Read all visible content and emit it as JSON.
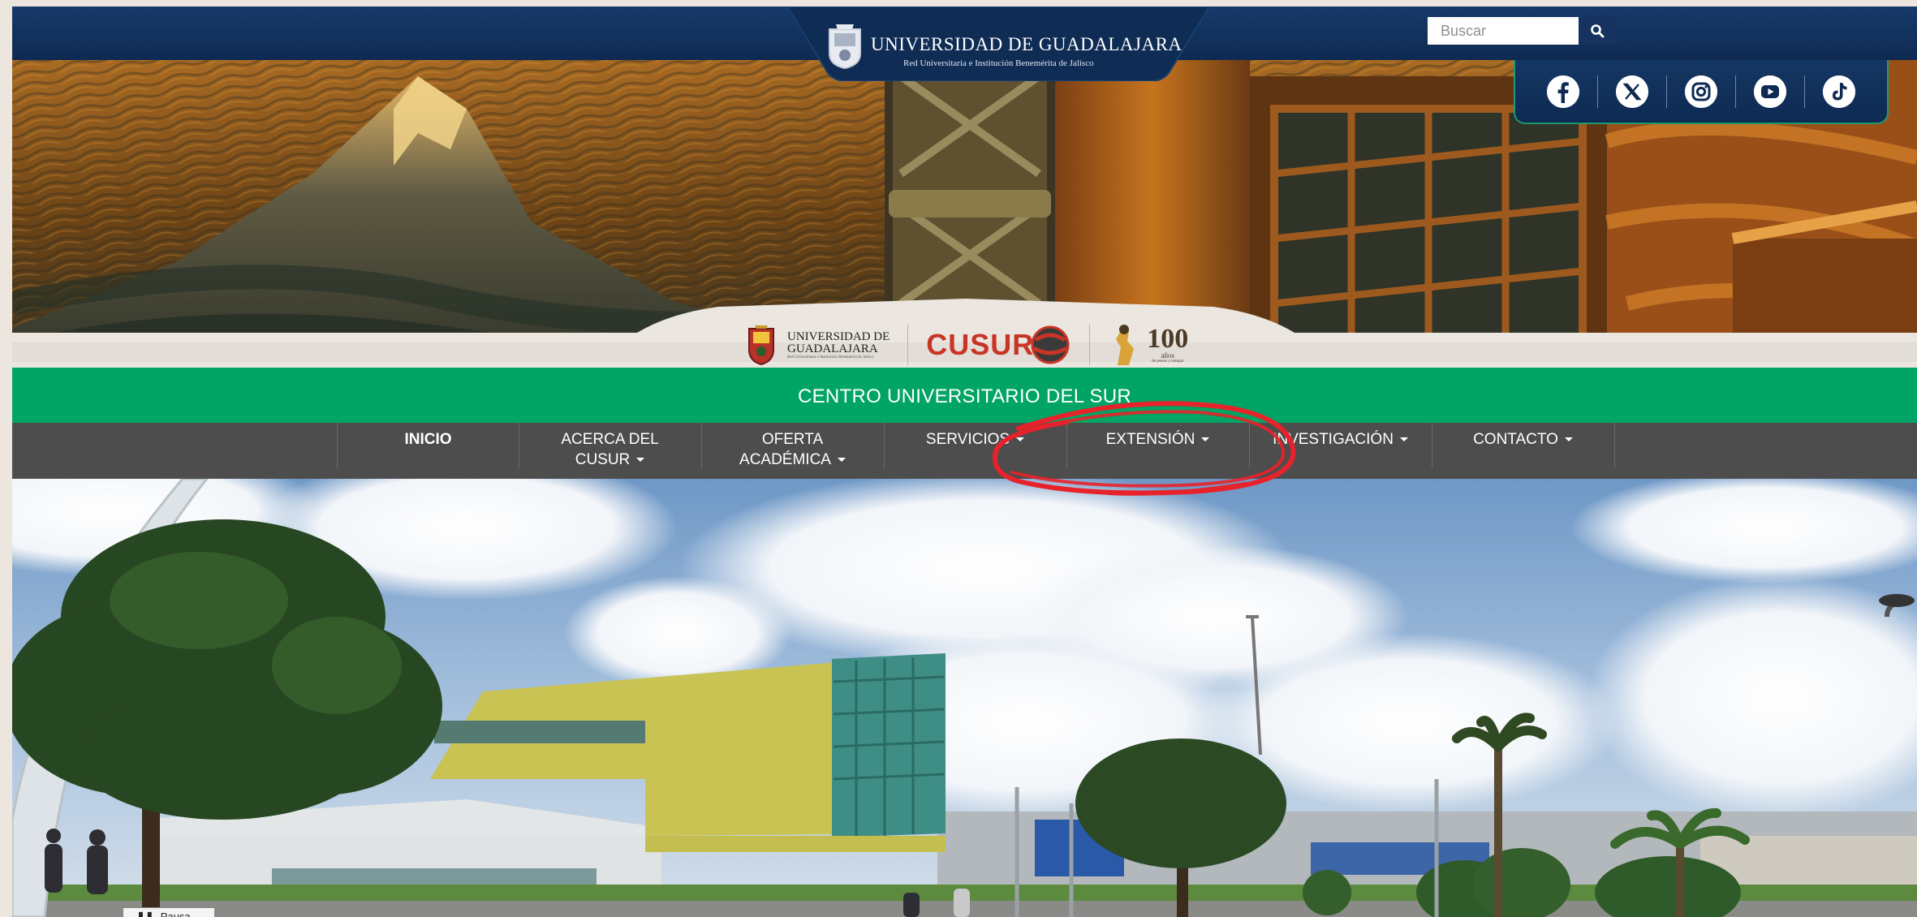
{
  "header": {
    "university_name": "UNIVERSIDAD DE GUADALAJARA",
    "university_subtitle": "Red Universitaria e Institución Benemérita de Jalisco"
  },
  "search": {
    "placeholder": "Buscar",
    "button_icon": "search-icon"
  },
  "social": [
    {
      "name": "facebook",
      "icon": "facebook-icon"
    },
    {
      "name": "x",
      "icon": "x-icon"
    },
    {
      "name": "instagram",
      "icon": "instagram-icon"
    },
    {
      "name": "youtube",
      "icon": "youtube-icon"
    },
    {
      "name": "tiktok",
      "icon": "tiktok-icon"
    }
  ],
  "logos": {
    "udg_line1": "UNIVERSIDAD DE",
    "udg_line2": "GUADALAJARA",
    "udg_sub": "Red Universitaria e Institución Benemérita de Jalisco",
    "cusur": "CUSUR",
    "centenario_number": "100",
    "centenario_word": "años",
    "centenario_sub": "de pensar y trabajar"
  },
  "title_bar": {
    "text": "CENTRO UNIVERSITARIO DEL SUR"
  },
  "nav": [
    {
      "line1": "INICIO",
      "line2": "",
      "dropdown": false,
      "active": true
    },
    {
      "line1": "ACERCA DEL",
      "line2": "CUSUR",
      "dropdown": true,
      "active": false
    },
    {
      "line1": "OFERTA",
      "line2": "ACADÉMICA",
      "dropdown": true,
      "active": false
    },
    {
      "line1": "SERVICIOS",
      "line2": "",
      "dropdown": true,
      "active": false
    },
    {
      "line1": "EXTENSIÓN",
      "line2": "",
      "dropdown": true,
      "active": false
    },
    {
      "line1": "INVESTIGACIÓN",
      "line2": "",
      "dropdown": true,
      "active": false
    },
    {
      "line1": "CONTACTO",
      "line2": "",
      "dropdown": true,
      "active": false
    }
  ],
  "annotation": {
    "highlighted_item": "EXTENSIÓN",
    "color": "#e8222a"
  },
  "hero": {
    "badge_label": "Pausa"
  },
  "colors": {
    "header_blue": "#0e2a52",
    "green_bar": "#00a565",
    "nav_gray": "#4d4d4d",
    "accent_teal": "#1f9a6f"
  }
}
